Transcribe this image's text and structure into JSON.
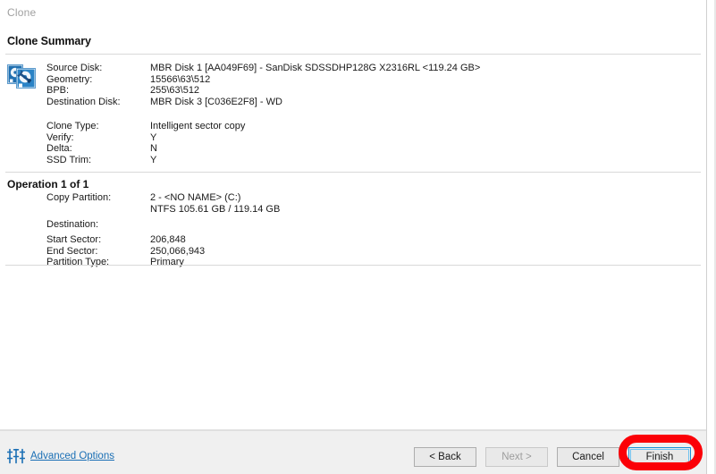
{
  "window": {
    "wizard_title": "Clone",
    "page_title": "Clone Summary"
  },
  "summary": {
    "icon": "disk-clone-icon",
    "disk_rows": [
      {
        "label": "Source Disk:",
        "value": "MBR Disk 1 [AA049F69] - SanDisk SDSSDHP128G X2316RL  <119.24 GB>"
      },
      {
        "label": "Geometry:",
        "value": "15566\\63\\512"
      },
      {
        "label": "BPB:",
        "value": "255\\63\\512"
      },
      {
        "label": "Destination Disk:",
        "value": "MBR Disk 3 [C036E2F8] - WD"
      }
    ],
    "clone_rows": [
      {
        "label": "Clone Type:",
        "value": "Intelligent sector copy"
      },
      {
        "label": "Verify:",
        "value": "Y"
      },
      {
        "label": "Delta:",
        "value": "N"
      },
      {
        "label": "SSD Trim:",
        "value": "Y"
      }
    ]
  },
  "operation": {
    "heading": "Operation 1 of 1",
    "rows": [
      {
        "label": "Copy Partition:",
        "value": "2 - <NO NAME> (C:)"
      },
      {
        "label": "",
        "value": "NTFS 105.61 GB / 119.14 GB"
      },
      {
        "label": "Destination:",
        "value": ""
      },
      {
        "label": "Start Sector:",
        "value": "206,848"
      },
      {
        "label": "End Sector:",
        "value": "250,066,943"
      },
      {
        "label": "Partition Type:",
        "value": "Primary"
      }
    ]
  },
  "footer": {
    "advanced_options_label": "Advanced Options",
    "advanced_options_icon": "sliders-icon",
    "buttons": {
      "back": "< Back",
      "next": "Next >",
      "cancel": "Cancel",
      "finish": "Finish"
    }
  },
  "colors": {
    "link": "#1a6fb5",
    "annotation": "#fb0007",
    "focus_border": "#1a8fd4",
    "footer_bg": "#f0f0f0",
    "title_gray": "#a0a0a0"
  }
}
